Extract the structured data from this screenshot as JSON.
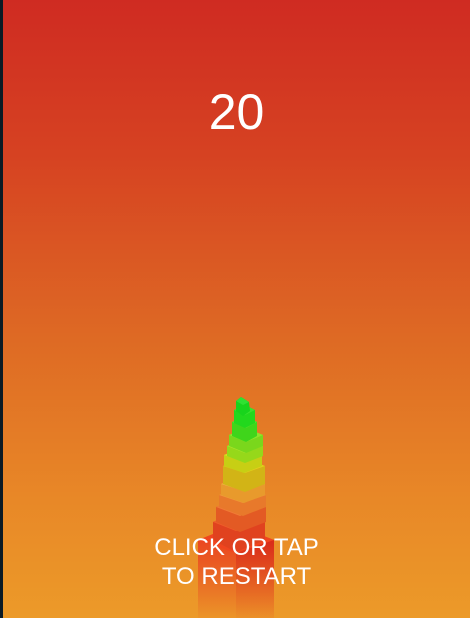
{
  "score": "20",
  "instructions": {
    "line1": "CLICK OR TAP",
    "line2": "TO RESTART"
  },
  "colors": {
    "background_top": "#cf2b22",
    "background_bottom": "#ec9a29",
    "text": "#ffffff"
  },
  "stack": {
    "block_count": 20,
    "block_colors_bottom_to_top": [
      "#e8341f",
      "#e55a24",
      "#e87a2b",
      "#eaa22a",
      "#d9c51a",
      "#b7dc1c",
      "#7be41f",
      "#1ddb1d"
    ]
  }
}
